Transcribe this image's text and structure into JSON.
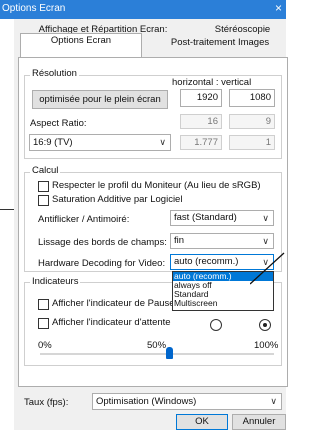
{
  "window": {
    "title": "Options Ecran",
    "close": "×"
  },
  "tabs": {
    "row1": [
      "Affichage et Répartition Ecran:",
      "Stéréoscopie"
    ],
    "row2": [
      "Options Ecran",
      "Post-traitement Images"
    ]
  },
  "resolution": {
    "group": "Résolution",
    "header": "horizontal : vertical",
    "optimize_button": "optimisée pour le plein écran",
    "width": "1920",
    "height": "1080",
    "aspect_label": "Aspect Ratio:",
    "aspect_w": "16",
    "aspect_h": "9",
    "aspect_select": "16:9 (TV)",
    "ratio": "1.777",
    "ratio_h": "1"
  },
  "calcul": {
    "group": "Calcul",
    "monitor_profile": "Respecter le profil du Moniteur (Au lieu de sRGB)",
    "additive_saturation": "Saturation Additive par Logiciel",
    "antiflicker_label": "Antiflicker / Antimoiré:",
    "antiflicker_value": "fast (Standard)",
    "smoothing_label": "Lissage des bords de champs:",
    "smoothing_value": "fin",
    "hw_decoding_label": "Hardware Decoding for Video:",
    "hw_decoding_value": "auto (recomm.)",
    "hw_decoding_options": [
      "auto (recomm.)",
      "always off",
      "Standard",
      "Multiscreen"
    ]
  },
  "indicators": {
    "group": "Indicateurs",
    "pause": "Afficher l'indicateur de Pause",
    "wait": "Afficher l'indicateur d'attente",
    "slider_min": "0%",
    "slider_mid": "50%",
    "slider_max": "100%",
    "slider_value": 0.55
  },
  "fps": {
    "label": "Taux (fps):",
    "value": "Optimisation (Windows)"
  },
  "buttons": {
    "ok": "OK",
    "cancel": "Annuler"
  }
}
